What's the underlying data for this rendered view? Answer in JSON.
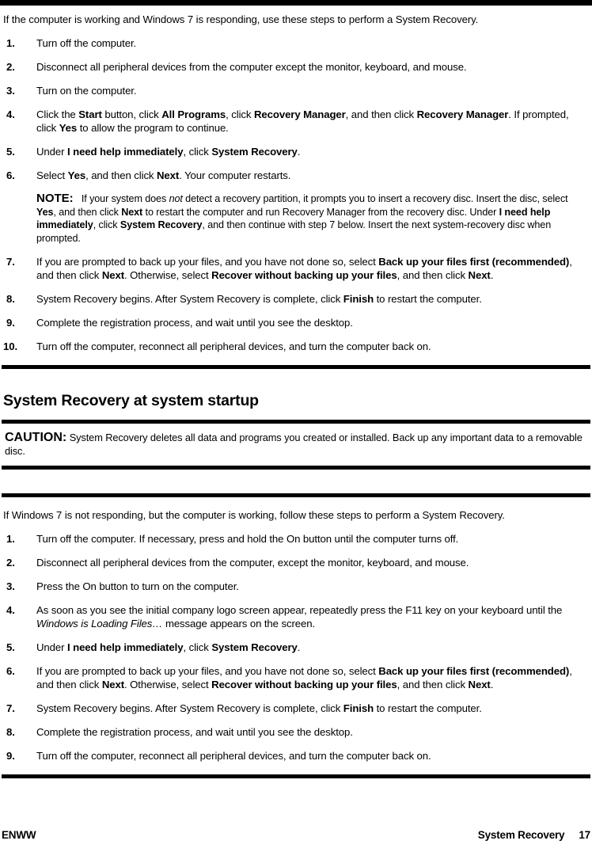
{
  "page": {
    "footer_left": "ENWW",
    "footer_section": "System Recovery",
    "footer_page": "17"
  },
  "section_one": {
    "intro": "If the computer is working and Windows 7 is responding, use these steps to perform a System Recovery.",
    "steps": [
      {
        "num": "1.",
        "text": "Turn off the computer."
      },
      {
        "num": "2.",
        "text": "Disconnect all peripheral devices from the computer except the monitor, keyboard, and mouse."
      },
      {
        "num": "3.",
        "text": "Turn on the computer."
      },
      {
        "num": "4.",
        "text": "Click the Start button, click All Programs, click Recovery Manager, and then click Recovery Manager. If prompted, click Yes to allow the program to continue."
      },
      {
        "num": "5.",
        "text": "Under I need help immediately, click System Recovery."
      },
      {
        "num": "6.",
        "text": "Select Yes, and then click Next. Your computer restarts."
      },
      {
        "num": "7.",
        "text": "If you are prompted to back up your files, and you have not done so, select Back up your files first (recommended), and then click Next. Otherwise, select Recover without backing up your files, and then click Next."
      },
      {
        "num": "8.",
        "text": "System Recovery begins. After System Recovery is complete, click Finish to restart the computer."
      },
      {
        "num": "9.",
        "text": "Complete the registration process, and wait until you see the desktop."
      },
      {
        "num": "10.",
        "text": "Turn off the computer, reconnect all peripheral devices, and turn the computer back on."
      }
    ],
    "note_label": "NOTE:",
    "note_text": "If your system does not detect a recovery partition, it prompts you to insert a recovery disc. Insert the disc, select Yes, and then click Next to restart the computer and run Recovery Manager from the recovery disc. Under I need help immediately, click System Recovery, and then continue with step 7 below. Insert the next system-recovery disc when prompted."
  },
  "section_two": {
    "heading": "System Recovery at system startup",
    "caution_label": "CAUTION:",
    "caution_text": "System Recovery deletes all data and programs you created or installed. Back up any important data to a removable disc.",
    "intro": "If Windows 7 is not responding, but the computer is working, follow these steps to perform a System Recovery.",
    "steps": [
      {
        "num": "1.",
        "text": "Turn off the computer. If necessary, press and hold the On button until the computer turns off."
      },
      {
        "num": "2.",
        "text": "Disconnect all peripheral devices from the computer, except the monitor, keyboard, and mouse."
      },
      {
        "num": "3.",
        "text": "Press the On button to turn on the computer."
      },
      {
        "num": "4.",
        "text": "As soon as you see the initial company logo screen appear, repeatedly press the F11 key on your keyboard until the Windows is Loading Files… message appears on the screen."
      },
      {
        "num": "5.",
        "text": "Under I need help immediately, click System Recovery."
      },
      {
        "num": "6.",
        "text": "If you are prompted to back up your files, and you have not done so, select Back up your files first (recommended), and then click Next. Otherwise, select Recover without backing up your files, and then click Next."
      },
      {
        "num": "7.",
        "text": "System Recovery begins. After System Recovery is complete, click Finish to restart the computer."
      },
      {
        "num": "8.",
        "text": "Complete the registration process, and wait until you see the desktop."
      },
      {
        "num": "9.",
        "text": "Turn off the computer, reconnect all peripheral devices, and turn the computer back on."
      }
    ]
  }
}
